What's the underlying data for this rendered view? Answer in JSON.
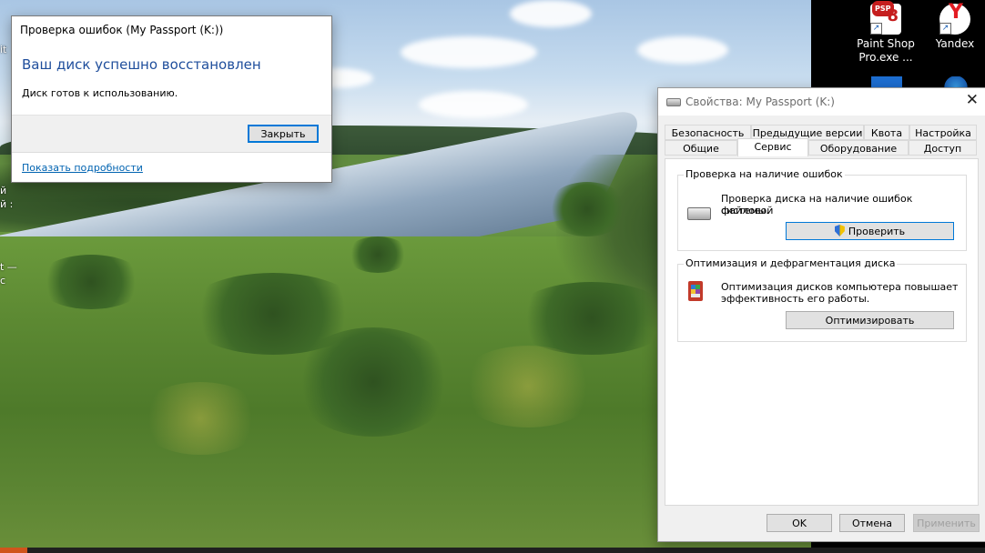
{
  "desktop": {
    "clipped_labels": [
      "it",
      "й",
      "й :",
      "t —",
      "c"
    ],
    "icons": [
      {
        "label_line1": "Paint Shop",
        "label_line2": "Pro.exe ...",
        "badge": "PSP",
        "num": "8"
      },
      {
        "label_line1": "Yandex",
        "label_line2": ""
      }
    ]
  },
  "check_dialog": {
    "title": "Проверка ошибок (My Passport (K:))",
    "heading": "Ваш диск успешно восстановлен",
    "message": "Диск готов к использованию.",
    "close_button": "Закрыть",
    "details_link": "Показать подробности"
  },
  "properties": {
    "title": "Свойства: My Passport (K:)",
    "close_glyph": "✕",
    "tabs_row1": [
      "Безопасность",
      "Предыдущие версии",
      "Квота",
      "Настройка"
    ],
    "tabs_row2": [
      "Общие",
      "Сервис",
      "Оборудование",
      "Доступ"
    ],
    "active_tab": "Сервис",
    "error_group": {
      "title": "Проверка на наличие ошибок",
      "text_line1": "Проверка диска на наличие ошибок файловой",
      "text_line2": "системы.",
      "button": "Проверить"
    },
    "optimize_group": {
      "title": "Оптимизация и дефрагментация диска",
      "text_line1": "Оптимизация дисков компьютера повышает",
      "text_line2": "эффективность его работы.",
      "button": "Оптимизировать"
    },
    "buttons": {
      "ok": "OK",
      "cancel": "Отмена",
      "apply": "Применить"
    }
  },
  "colors": {
    "heading_blue": "#1f4e9c",
    "link_blue": "#0063b1",
    "focus_blue": "#0078d7"
  }
}
